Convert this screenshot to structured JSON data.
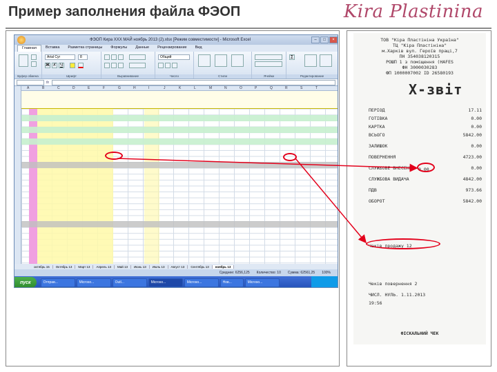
{
  "slide": {
    "title": "Пример заполнения файла ФЭОП",
    "logo": "Kira Plastinina"
  },
  "excel": {
    "window_title": "ФЭОП Кира XXX МАЙ ноябрь 2013 (2).xlsx [Режим совместимости] - Microsoft Excel",
    "ribbon_tabs": [
      "Главная",
      "Вставка",
      "Разметка страницы",
      "Формулы",
      "Данные",
      "Рецензирование",
      "Вид"
    ],
    "ribbon_groups": [
      "Буфер обмена",
      "Шрифт",
      "Выравнивание",
      "Число",
      "Стили",
      "Ячейки",
      "Редактирование"
    ],
    "font_name": "Arial Cyr",
    "font_size": "8",
    "number_format": "Общий",
    "column_letters": [
      "A",
      "B",
      "C",
      "D",
      "E",
      "F",
      "G",
      "H",
      "I",
      "J",
      "K",
      "L",
      "M",
      "N",
      "O",
      "P",
      "Q",
      "R",
      "S",
      "T"
    ],
    "sheet_tabs": [
      "октябрь 15",
      "Октябрь 13",
      "Март 13",
      "Апрель 13",
      "Май 13",
      "Июнь 13",
      "Июль 13",
      "Август 13",
      "Сентябрь 13",
      "ноябрь 13"
    ],
    "active_sheet": "ноябрь 13",
    "status": {
      "average": "Среднее: 6256,125",
      "count": "Количество: 10",
      "sum": "Сумма: 62561,25",
      "zoom": "100%"
    },
    "taskbar": {
      "start": "пуск",
      "items": [
        "Отправ...",
        "Microso...",
        "Outl...",
        "Microso...",
        "Microso...",
        "Нов...",
        "Microso..."
      ]
    }
  },
  "receipt": {
    "header_lines": [
      "ТОВ \"Кіра Пластініна Україна\"",
      "ТЦ \"Кіра Пластініна\"",
      "м.Харків вул. Героїв праці,7",
      "ПН 354038120315",
      "РОШП 1 з поміщення (HAFES",
      "ФН 3000030283",
      "ФП 1000007002 ID 26580193"
    ],
    "report_title": "Х-звіт",
    "lines": [
      {
        "label": "ПЕРІОД",
        "value": "17.11"
      },
      {
        "label": "ГОТІВКА",
        "value": "0.00"
      },
      {
        "label": "КАРТКА",
        "value": "0.00"
      },
      {
        "label": "ВСЬОГО",
        "value": "5842.00"
      },
      {
        "label": "ЗАЛИШОК",
        "value": "0.00"
      },
      {
        "label": "ПОВЕРНЕННЯ",
        "value": "4723.00"
      },
      {
        "label": "СЛУЖБОВЕ ВНЕСЕННЯ",
        "value": "0.00"
      },
      {
        "label": "СЛУЖБОВА ВИДАЧА",
        "value": "4842.00"
      },
      {
        "label": "ПДВ",
        "value": "973.66"
      },
      {
        "label": "ОБОРОТ",
        "value": "5842.00"
      }
    ],
    "highlight_1": "0.00",
    "highlight_2": "Чеків продажу 12",
    "footer_lines": [
      "Чеків повернення 2",
      "ЧИСЛ. НУЛЬ. 1.11.2013",
      "19:56",
      "ФІСКАЛЬНИЙ ЧЕК"
    ]
  },
  "colors": {
    "highlight_red": "#e3001b",
    "excel_yellow": "#fff9a8",
    "excel_green": "#c6efce",
    "excel_pink": "#f0a0e0",
    "excel_grey": "#bfbfbf"
  }
}
